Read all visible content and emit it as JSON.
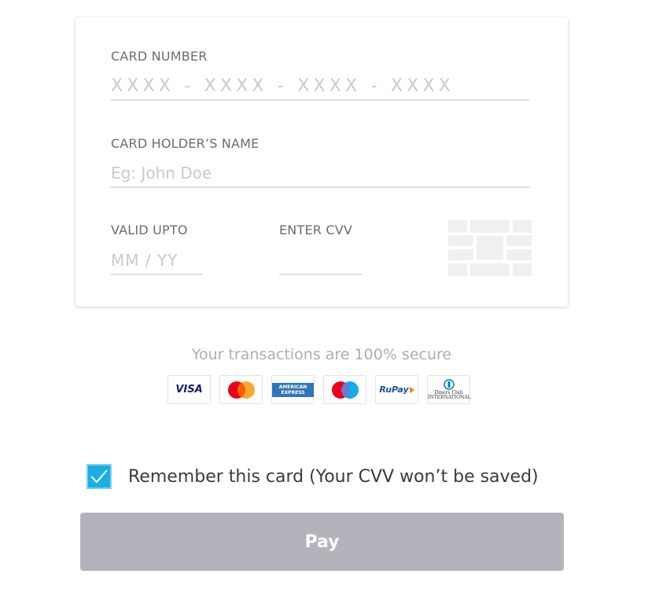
{
  "card_form": {
    "card_number": {
      "label": "CARD NUMBER",
      "placeholder": "XXXX - XXXX - XXXX - XXXX",
      "value": ""
    },
    "card_holder": {
      "label": "CARD HOLDER’S NAME",
      "placeholder": "Eg: John Doe",
      "value": ""
    },
    "valid_upto": {
      "label": "VALID UPTO",
      "placeholder": "MM / YY",
      "value": ""
    },
    "cvv": {
      "label": "ENTER CVV",
      "placeholder": "",
      "value": ""
    },
    "chip_icon": "card-chip-icon"
  },
  "security": {
    "text": "Your transactions are 100% secure",
    "logos": [
      {
        "name": "visa-logo",
        "label": "VISA"
      },
      {
        "name": "mastercard-logo",
        "label": ""
      },
      {
        "name": "american-express-logo",
        "label": "AMERICAN EXPRESS"
      },
      {
        "name": "maestro-logo",
        "label": ""
      },
      {
        "name": "rupay-logo",
        "label": "RuPay"
      },
      {
        "name": "diners-club-logo",
        "label": "Diners Club INTERNATIONAL"
      }
    ]
  },
  "remember": {
    "checked": true,
    "label": "Remember this card (Your CVV won’t be saved)"
  },
  "pay_button": {
    "label": "Pay"
  },
  "colors": {
    "checkbox": "#1aafe0",
    "pay_button_disabled": "#b3b3bb",
    "mastercard_red": "#eb001b",
    "mastercard_orange": "#f79e1b",
    "maestro_blue": "#00a2e5"
  }
}
